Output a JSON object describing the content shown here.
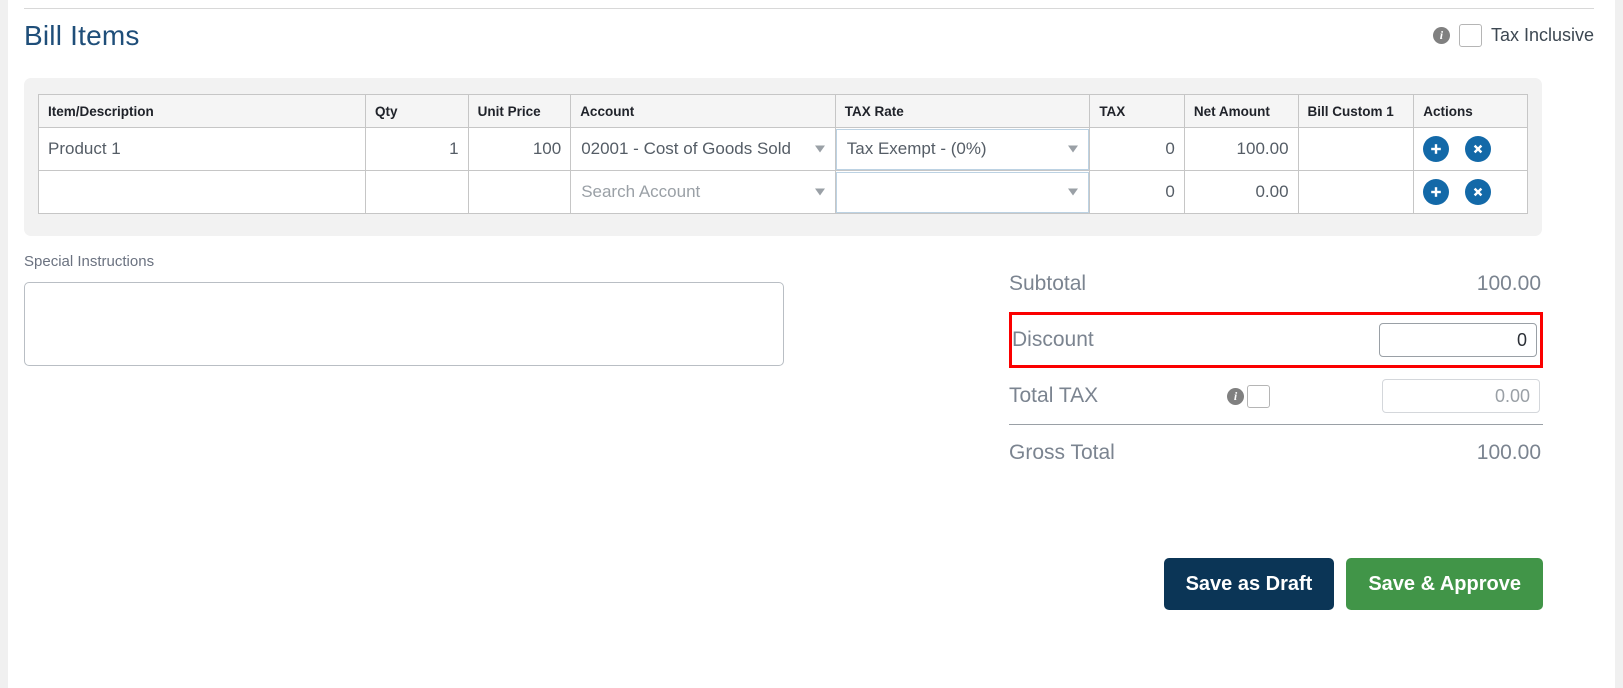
{
  "header": {
    "title": "Bill Items",
    "info_icon": "info-icon",
    "tax_inclusive_label": "Tax Inclusive",
    "tax_inclusive_checked": false
  },
  "table": {
    "columns": [
      "Item/Description",
      "Qty",
      "Unit Price",
      "Account",
      "TAX Rate",
      "TAX",
      "Net Amount",
      "Bill Custom 1",
      "Actions"
    ],
    "rows": [
      {
        "item": "Product 1",
        "qty": "1",
        "unit_price": "100",
        "account": "02001 - Cost of Goods Sold",
        "tax_rate": "Tax Exempt - (0%)",
        "tax": "0",
        "net_amount": "100.00",
        "bill_custom_1": "",
        "add_icon": "plus-icon",
        "remove_icon": "close-icon"
      },
      {
        "item": "",
        "qty": "",
        "unit_price": "",
        "account": "",
        "account_placeholder": "Search Account",
        "tax_rate": "",
        "tax": "0",
        "net_amount": "0.00",
        "bill_custom_1": "",
        "add_icon": "plus-icon",
        "remove_icon": "close-icon"
      }
    ]
  },
  "special_instructions": {
    "label": "Special Instructions",
    "value": "",
    "placeholder": ""
  },
  "totals": {
    "subtotal_label": "Subtotal",
    "subtotal_value": "100.00",
    "discount_label": "Discount",
    "discount_value": "0",
    "total_tax_label": "Total TAX",
    "total_tax_info_icon": "info-icon",
    "total_tax_checked": false,
    "total_tax_value": "0.00",
    "gross_total_label": "Gross Total",
    "gross_total_value": "100.00"
  },
  "footer": {
    "save_draft_label": "Save as Draft",
    "save_approve_label": "Save & Approve"
  },
  "colors": {
    "title": "#1f4e79",
    "accent_blue": "#1369a8",
    "draft_button": "#0b3556",
    "approve_button": "#419548",
    "highlight": "#fb0000"
  }
}
